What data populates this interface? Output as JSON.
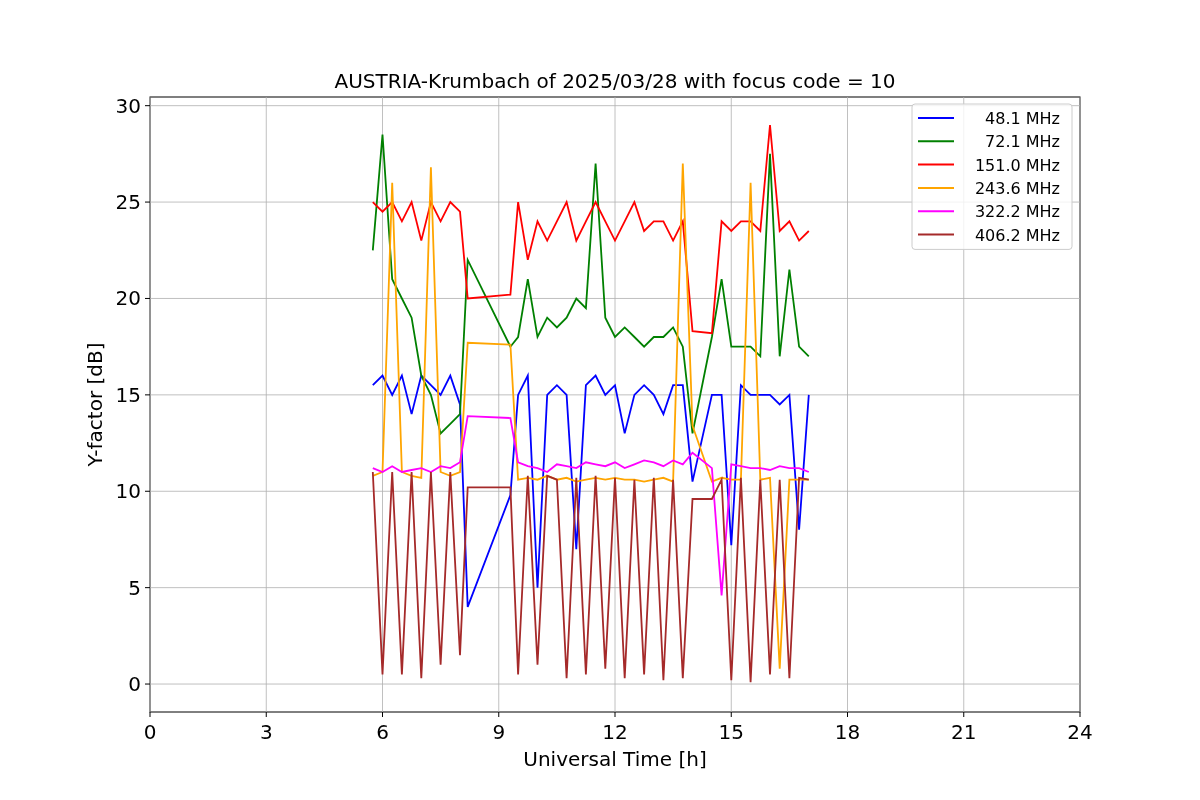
{
  "chart_data": {
    "type": "line",
    "title": "AUSTRIA-Krumbach of 2025/03/28 with focus code = 10",
    "xlabel": "Universal Time [h]",
    "ylabel": "Y-factor [dB]",
    "x": [
      5.75,
      6.0,
      6.25,
      6.5,
      6.75,
      7.0,
      7.25,
      7.5,
      7.75,
      8.0,
      8.2,
      9.3,
      9.5,
      9.75,
      10,
      10.25,
      10.5,
      10.75,
      11,
      11.25,
      11.5,
      11.75,
      12,
      12.25,
      12.5,
      12.75,
      13,
      13.25,
      13.5,
      13.75,
      14.0,
      14.5,
      14.75,
      15,
      15.25,
      15.5,
      15.75,
      16,
      16.25,
      16.5,
      16.75,
      17.0
    ],
    "series": [
      {
        "name": "48.1 MHz",
        "color": "#0000ff",
        "values": [
          15.5,
          16,
          15,
          16,
          14,
          16,
          15.5,
          15,
          16,
          14.5,
          4,
          9.8,
          15,
          16,
          5,
          15,
          15.5,
          15,
          7,
          15.5,
          16,
          15,
          15.5,
          13,
          15,
          15.5,
          15,
          14,
          15.5,
          15.5,
          10.5,
          15,
          15,
          7.2,
          15.5,
          15,
          15,
          15,
          14.5,
          15,
          8,
          15
        ]
      },
      {
        "name": "72.1 MHz",
        "color": "#008000",
        "values": [
          22.5,
          28.5,
          21,
          20,
          19,
          16,
          15,
          13,
          13.5,
          14,
          22,
          17.5,
          18,
          21,
          18,
          19,
          18.5,
          19,
          20,
          19.5,
          27,
          19,
          18,
          18.5,
          18,
          17.5,
          18,
          18,
          18.5,
          17.5,
          13,
          18,
          21,
          17.5,
          17.5,
          17.5,
          17,
          27.5,
          17,
          21.5,
          17.5,
          17
        ]
      },
      {
        "name": "151.0 MHz",
        "color": "#ff0000",
        "values": [
          25,
          24.5,
          25,
          24,
          25,
          23,
          25,
          24,
          25,
          24.5,
          20,
          20.2,
          25,
          22,
          24,
          23,
          24,
          25,
          23,
          24,
          25,
          24,
          23,
          24,
          25,
          23.5,
          24,
          24,
          23,
          24,
          18.3,
          18.2,
          24,
          23.5,
          24,
          24,
          23.5,
          29,
          23.5,
          24,
          23,
          23.5
        ]
      },
      {
        "name": "243.6 MHz",
        "color": "#ffa500",
        "values": [
          10.8,
          11,
          26,
          11,
          10.8,
          10.7,
          26.8,
          11,
          10.8,
          11,
          17.7,
          17.6,
          10.6,
          10.7,
          10.6,
          10.8,
          10.6,
          10.7,
          10.5,
          10.6,
          10.7,
          10.6,
          10.7,
          10.6,
          10.6,
          10.5,
          10.6,
          10.7,
          10.5,
          27,
          13.4,
          10.5,
          10.7,
          10.6,
          10.6,
          26,
          10.6,
          10.7,
          0.8,
          10.6,
          10.6,
          10.6
        ]
      },
      {
        "name": "322.2 MHz",
        "color": "#ff00ff",
        "values": [
          11.2,
          11,
          11.3,
          11,
          11.1,
          11.2,
          11,
          11.3,
          11.2,
          11.5,
          13.9,
          13.8,
          11.5,
          11.3,
          11.2,
          11,
          11.4,
          11.3,
          11.2,
          11.5,
          11.4,
          11.3,
          11.5,
          11.2,
          11.4,
          11.6,
          11.5,
          11.3,
          11.6,
          11.4,
          12,
          11.2,
          4.6,
          11.4,
          11.3,
          11.2,
          11.2,
          11.1,
          11.3,
          11.2,
          11.2,
          11
        ]
      },
      {
        "name": "406.2 MHz",
        "color": "#a52a2a",
        "values": [
          11,
          0.5,
          11,
          0.5,
          11,
          0.3,
          11,
          1,
          11,
          1.5,
          10.2,
          10.2,
          0.5,
          10.8,
          1,
          10.8,
          10.6,
          0.3,
          10.7,
          0.5,
          10.8,
          0.8,
          10.7,
          0.3,
          10.6,
          0.5,
          10.7,
          0.2,
          10.6,
          0.3,
          9.6,
          9.6,
          10.6,
          0.2,
          10.7,
          0.1,
          10.6,
          0.5,
          10.6,
          0.3,
          10.7,
          10.6
        ]
      }
    ],
    "xlim": [
      0,
      24
    ],
    "ylim": [
      -1.45,
      30.45
    ],
    "xticks": [
      0,
      3,
      6,
      9,
      12,
      15,
      18,
      21,
      24
    ],
    "yticks": [
      0,
      5,
      10,
      15,
      20,
      25,
      30
    ],
    "grid": true,
    "legend": "upper right"
  }
}
